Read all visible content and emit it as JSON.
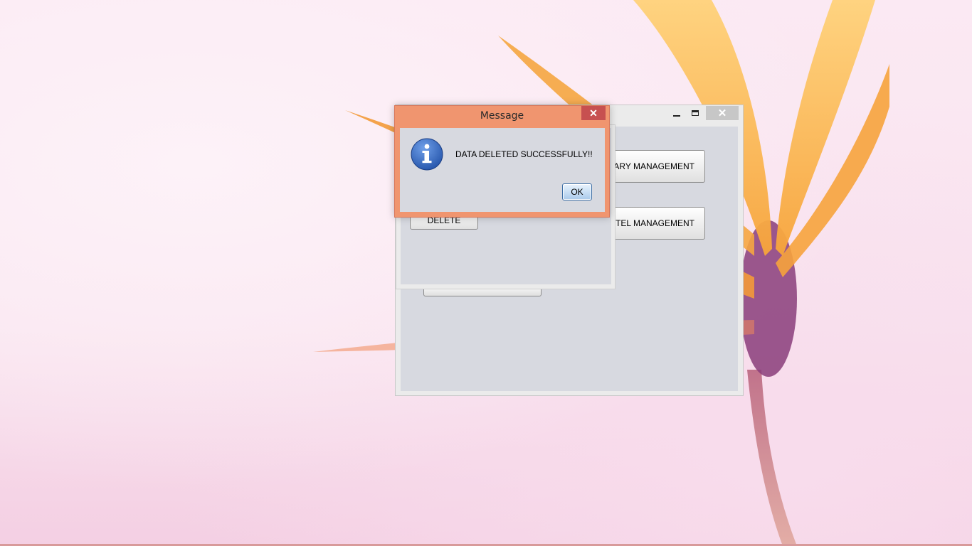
{
  "main_window": {
    "buttons": {
      "library": "RARY MANAGEMENT",
      "hostel": "STEL MANAGEMENT"
    }
  },
  "child_window": {
    "delete_label": "DELETE"
  },
  "dialog": {
    "title": "Message",
    "close_glyph": "✕",
    "icon": "info-icon",
    "message": "DATA DELETED SUCCESSFULLY!!",
    "ok_label": "OK"
  },
  "colors": {
    "dialog_frame": "#f0956f",
    "dialog_close": "#c75050",
    "client_area": "#d7d9e0",
    "info_icon": "#2f62b8"
  }
}
